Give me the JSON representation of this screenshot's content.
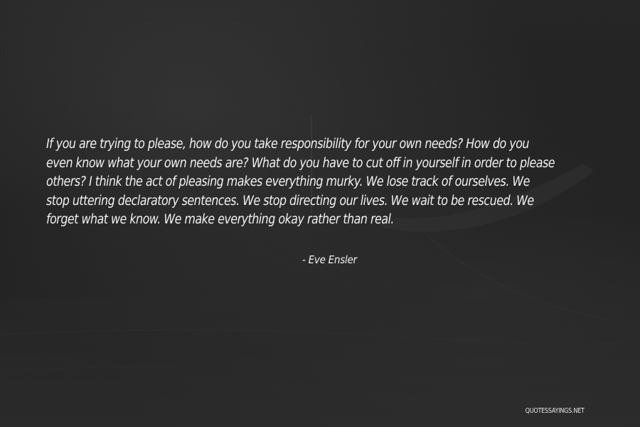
{
  "quote": {
    "lines": [
      "If you are trying to please, how do you take responsibility for your own needs? How do you",
      "even know what your own needs are? What do you have to cut off in yourself in order to please",
      "others? I think the act of pleasing makes everything murky. We lose track of ourselves. We",
      "stop uttering declaratory sentences. We stop directing our lives. We wait to be rescued. We",
      "forget what we know. We make everything okay rather than real."
    ],
    "author": "- Eve Ensler"
  },
  "watermark": "QUOTESSAYINGS.NET",
  "colors": {
    "background": "#1e1e1e",
    "text": "#f2f2f2"
  }
}
